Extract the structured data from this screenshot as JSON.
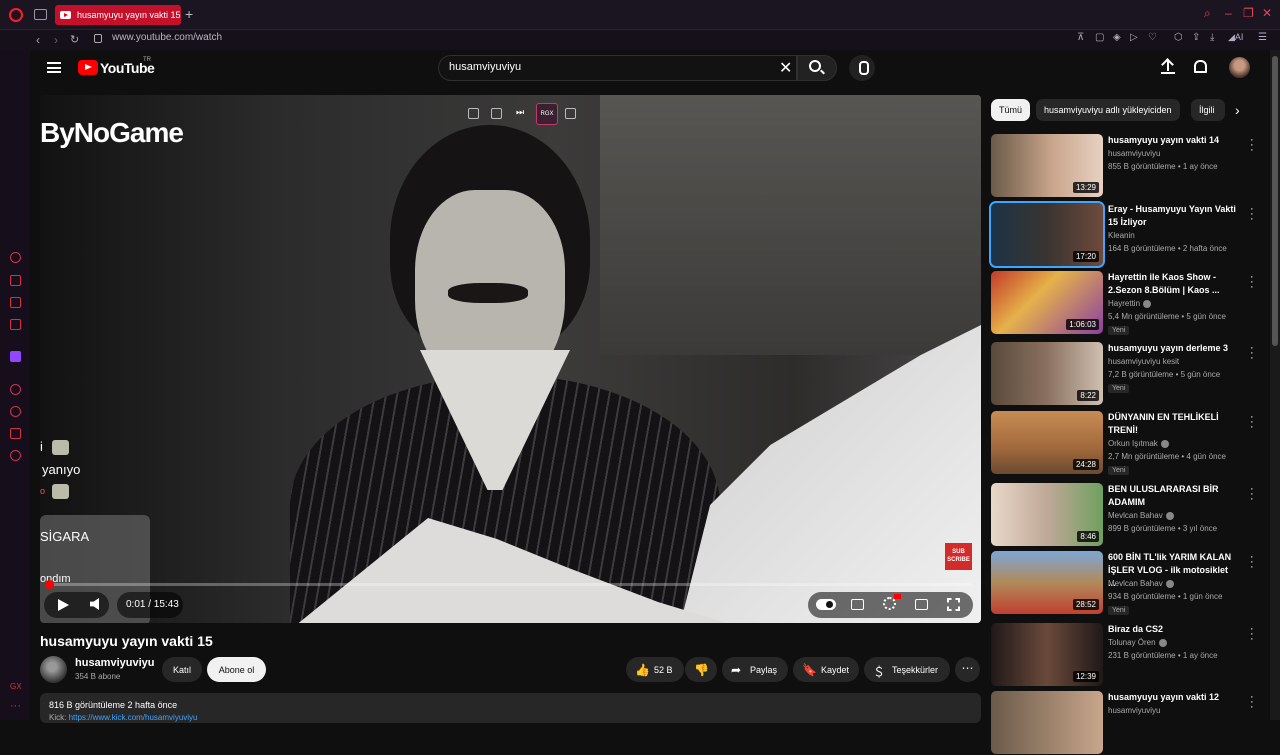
{
  "browser": {
    "tab_title": "husamyuyu yayın vakti 15",
    "url": "www.youtube.com/watch",
    "side_label": "GX"
  },
  "header": {
    "logo_text": "YouTube",
    "logo_region": "TR",
    "search_value": "husamviyuviyu"
  },
  "player": {
    "overlay_brand": "ByNoGame",
    "chat_lines": [
      "i",
      "yanıyo",
      "o",
      "SİGARA",
      "ondım",
      "... lam"
    ],
    "rgx_label": "RGX",
    "subscribe_label": "SUB SCRIBE",
    "time": "0:01 / 15:43",
    "progress": 0.001
  },
  "video": {
    "title": "husamyuyu yayın vakti 15",
    "channel_name": "husamviyuviyu",
    "subscribers": "354 B abone",
    "join_label": "Katıl",
    "subscribe_label": "Abone ol",
    "likes": "52 B",
    "share_label": "Paylaş",
    "save_label": "Kaydet",
    "thanks_label": "Teşekkürler",
    "description_meta": "816 B görüntüleme  2 hafta önce",
    "description_link_prefix": "Kick: ",
    "description_link": "https://www.kick.com/husamviyuviyu"
  },
  "sidebar": {
    "chips": [
      "Tümü",
      "husamviyuviyu adlı yükleyiciden",
      "İlgili"
    ],
    "items": [
      {
        "title": "husamyuyu yayın vakti 14",
        "channel": "husamviyuviyu",
        "meta": "855 B görüntüleme • 1 ay önce",
        "duration": "13:29",
        "badge": "",
        "verified": false
      },
      {
        "title": "Eray - Husamyuyu Yayın Vakti 15 İzliyor",
        "channel": "Kleanin",
        "meta": "164 B görüntüleme • 2 hafta önce",
        "duration": "17:20",
        "badge": "",
        "verified": false
      },
      {
        "title": "Hayrettin ile Kaos Show - 2.Sezon 8.Bölüm | Kaos ...",
        "channel": "Hayrettin",
        "meta": "5,4 Mn görüntüleme • 5 gün önce",
        "duration": "1:06:03",
        "badge": "Yeni",
        "verified": true
      },
      {
        "title": "husamyuyu yayın derleme 3",
        "channel": "husamviyuviyu kesit",
        "meta": "7,2 B görüntüleme • 5 gün önce",
        "duration": "8:22",
        "badge": "Yeni",
        "verified": false
      },
      {
        "title": "DÜNYANIN EN TEHLİKELİ TRENİ!",
        "channel": "Orkun Işıtmak",
        "meta": "2,7 Mn görüntüleme • 4 gün önce",
        "duration": "24:28",
        "badge": "Yeni",
        "verified": true
      },
      {
        "title": "BEN ULUSLARARASI BİR ADAMIM",
        "channel": "Mevlcan Bahav",
        "meta": "899 B görüntüleme • 3 yıl önce",
        "duration": "8:46",
        "badge": "",
        "verified": true
      },
      {
        "title": "600 BİN TL'lik YARIM KALAN İŞLER VLOG - ilk motosiklet ...",
        "channel": "Mevlcan Bahav",
        "meta": "934 B görüntüleme • 1 gün önce",
        "duration": "28:52",
        "badge": "Yeni",
        "verified": true
      },
      {
        "title": "Biraz da CS2",
        "channel": "Tolunay Ören",
        "meta": "231 B görüntüleme • 1 ay önce",
        "duration": "12:39",
        "badge": "",
        "verified": true
      },
      {
        "title": "husamyuyu yayın vakti 12",
        "channel": "husamviyuviyu",
        "meta": "",
        "duration": "",
        "badge": "",
        "verified": false
      }
    ]
  }
}
